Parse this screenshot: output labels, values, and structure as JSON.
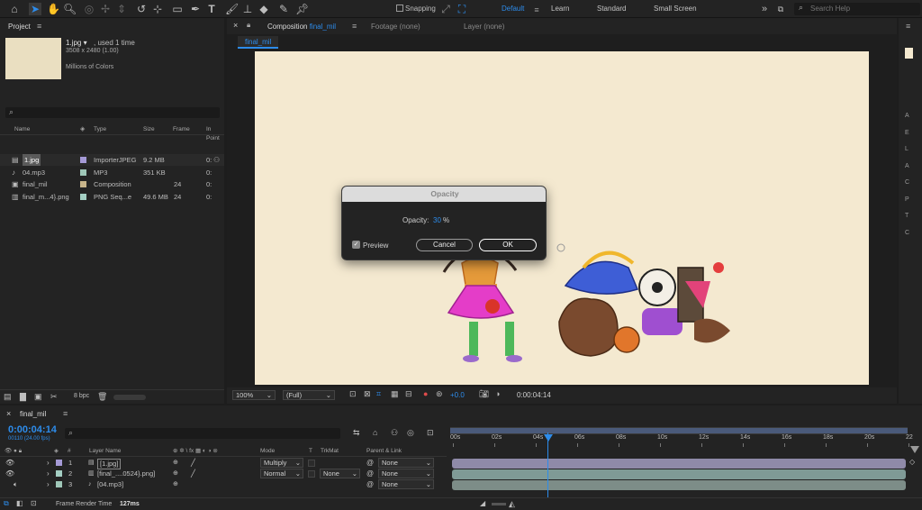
{
  "colors": {
    "accent": "#2d8ceb",
    "bg": "#1d1d1d",
    "panel": "#232323",
    "canvas": "#f4e9d0"
  },
  "toolbar": {
    "snapping_label": "Snapping",
    "workspaces": [
      "Default",
      "Learn",
      "Standard",
      "Small Screen"
    ],
    "search_placeholder": "Search Help"
  },
  "project": {
    "tab": "Project",
    "item_name": "1.jpg ▾",
    "item_used": ", used 1 time",
    "item_dims": "3508 x 2480 (1.00)",
    "item_colors": "Millions of Colors",
    "columns": {
      "name": "Name",
      "type": "Type",
      "size": "Size",
      "frame": "Frame ",
      "inpoint": "In Point"
    },
    "files": [
      {
        "name": "1.jpg",
        "type": "ImporterJPEG",
        "size": "9.2 MB",
        "frame": "",
        "inp": "0:",
        "color": "#a59ad6",
        "icon": "image-file-icon"
      },
      {
        "name": "04.mp3",
        "type": "MP3",
        "size": "351 KB",
        "frame": "",
        "inp": "0:",
        "color": "#9fc7b8",
        "icon": "audio-file-icon"
      },
      {
        "name": "final_mil",
        "type": "Composition",
        "size": "",
        "frame": "24",
        "inp": "0:",
        "color": "#c7b48a",
        "icon": "composition-icon"
      },
      {
        "name": "final_m...4}.png",
        "type": "PNG Seq...e",
        "size": "49.6 MB",
        "frame": "24",
        "inp": "0:",
        "color": "#a4cfc3",
        "icon": "image-sequence-icon"
      }
    ],
    "bpc": "8 bpc"
  },
  "viewer": {
    "comp_tab_prefix": "Composition",
    "comp_tab_name": "final_mil",
    "footage_tab": "Footage (none)",
    "layer_tab": "Layer (none)",
    "subtab": "final_mil",
    "zoom": "100%",
    "resolution": "(Full)",
    "exposure": "+0.0",
    "timecode": "0:00:04:14"
  },
  "dialog": {
    "title": "Opacity",
    "label": "Opacity:",
    "value": "30",
    "unit": "%",
    "preview_label": "Preview",
    "cancel": "Cancel",
    "ok": "OK"
  },
  "timeline": {
    "tab": "final_mil",
    "timecode": "0:00:04:14",
    "frameinfo": "00110 (24.00 fps)",
    "columns": {
      "layer_name": "Layer Name",
      "mode": "Mode",
      "t": "T",
      "trkmat": "TrkMat",
      "parent": "Parent & Link"
    },
    "layers": [
      {
        "num": "1",
        "name": "[1.jpg]",
        "mode": "Multiply",
        "trkmat": "",
        "parent": "None",
        "color": "#a59ad6"
      },
      {
        "num": "2",
        "name": "[final_....0524}.png]",
        "mode": "Normal",
        "trkmat": "None",
        "parent": "None",
        "color": "#a4cfc3"
      },
      {
        "num": "3",
        "name": "[04.mp3]",
        "mode": "",
        "trkmat": "",
        "parent": "None",
        "color": "#9fc7b8"
      }
    ],
    "ruler": [
      "00s",
      "02s",
      "04s",
      "06s",
      "08s",
      "10s",
      "12s",
      "14s",
      "16s",
      "18s",
      "20s",
      "22"
    ],
    "render_label": "Frame Render Time",
    "render_value": "127ms"
  }
}
